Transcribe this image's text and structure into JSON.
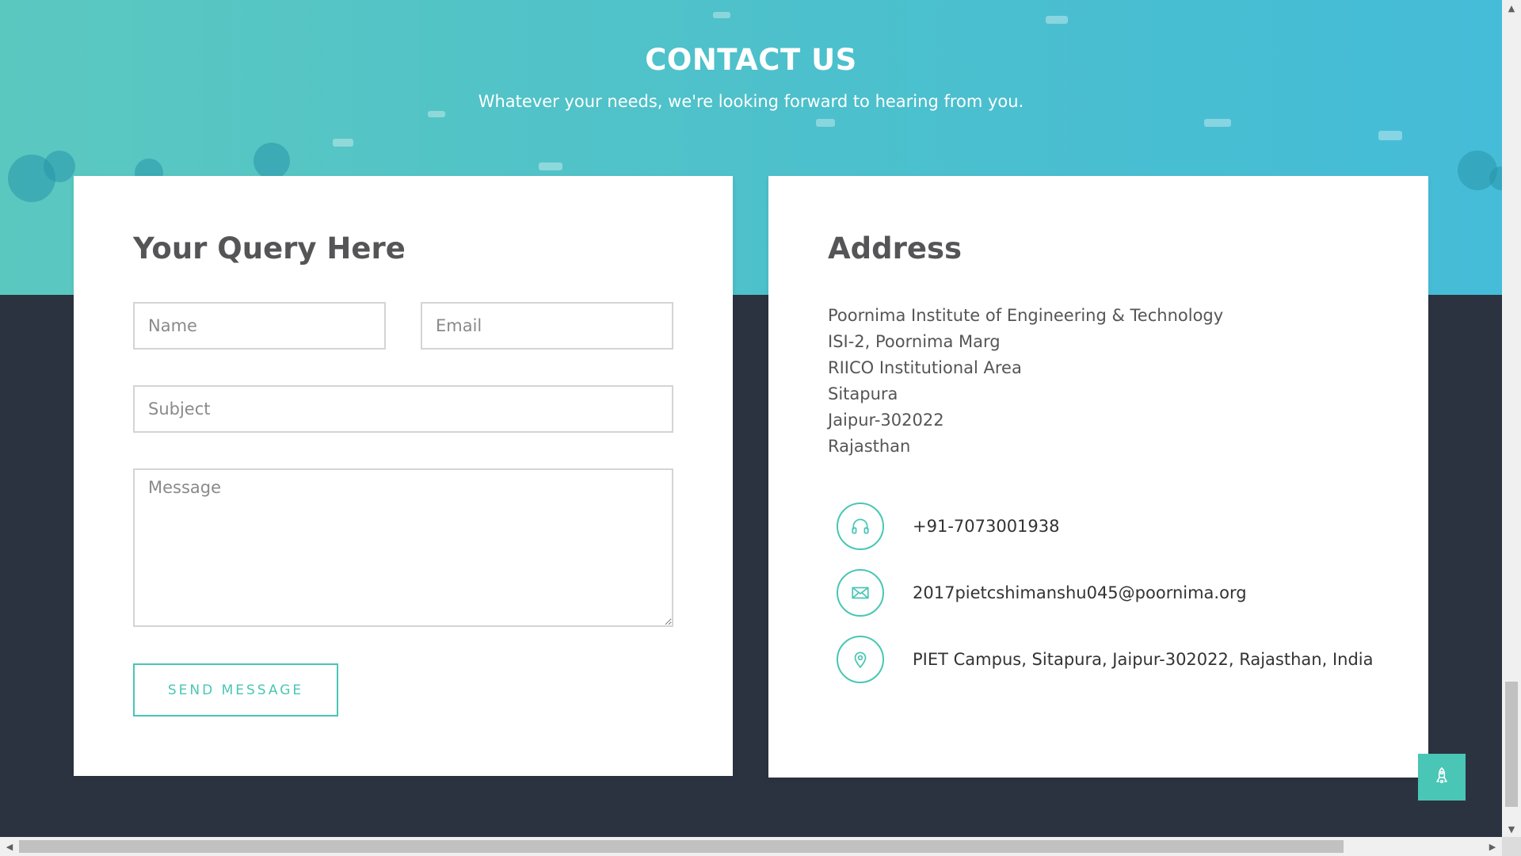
{
  "hero": {
    "title": "CONTACT US",
    "subtitle": "Whatever your needs, we're looking forward to hearing from you."
  },
  "query_form": {
    "heading": "Your Query Here",
    "name_placeholder": "Name",
    "email_placeholder": "Email",
    "subject_placeholder": "Subject",
    "message_placeholder": "Message",
    "send_label": "SEND MESSAGE"
  },
  "address": {
    "heading": "Address",
    "lines": [
      "Poornima Institute of Engineering & Technology",
      "ISI-2, Poornima Marg",
      "RIICO Institutional Area",
      "Sitapura",
      "Jaipur-302022",
      "Rajasthan"
    ],
    "phone": "+91-7073001938",
    "email": "2017pietcshimanshu045@poornima.org",
    "location": "PIET Campus, Sitapura, Jaipur-302022, Rajasthan, India"
  },
  "icons": {
    "phone": "headphones-icon",
    "email": "envelope-icon",
    "location": "map-pin-icon",
    "scroll_top": "rocket-icon"
  },
  "colors": {
    "accent": "#49c6b5",
    "dark_bg": "#2c3340",
    "heading_text": "#555557"
  }
}
